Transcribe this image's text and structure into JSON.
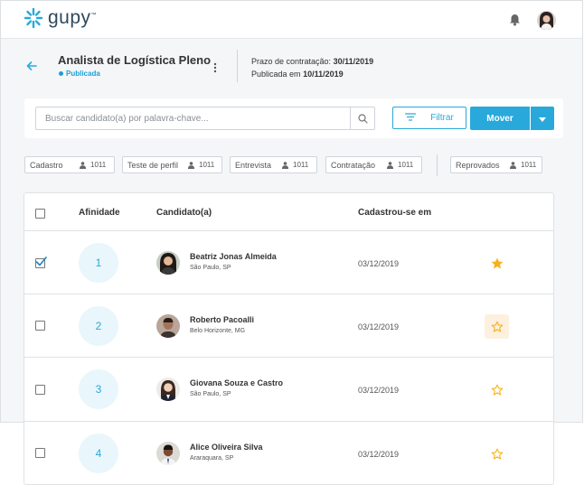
{
  "app": {
    "brand": "gupy",
    "brand_color": "#29a9db",
    "accent_star": "#f5b21d"
  },
  "topbar": {
    "icons": [
      "gupy-logo-icon",
      "bell-icon",
      "user-avatar"
    ]
  },
  "job": {
    "title": "Analista de Logística Pleno",
    "status": "Publicada",
    "deadline_label": "Prazo de contratação:",
    "deadline_value": "30/11/2019",
    "published_label": "Publicada em",
    "published_value": "10/11/2019"
  },
  "search": {
    "placeholder": "Buscar candidato(a) por palavra-chave...",
    "value": ""
  },
  "actions": {
    "filter_label": "Filtrar",
    "move_label": "Mover"
  },
  "stages": [
    {
      "label": "Cadastro",
      "count": "1011"
    },
    {
      "label": "Teste de perfil",
      "count": "1011"
    },
    {
      "label": "Entrevista",
      "count": "1011"
    },
    {
      "label": "Contratação",
      "count": "1011"
    },
    {
      "label": "Reprovados",
      "count": "1011"
    }
  ],
  "table": {
    "headers": {
      "affinity": "Afinidade",
      "candidate": "Candidato(a)",
      "registered": "Cadastrou-se em"
    },
    "rows": [
      {
        "checked": true,
        "affinity": "1",
        "name": "Beatriz Jonas Almeida",
        "location": "São Paulo, SP",
        "date": "03/12/2019",
        "starred": true
      },
      {
        "checked": false,
        "affinity": "2",
        "name": "Roberto Pacoalli",
        "location": "Belo Horizonte, MG",
        "date": "03/12/2019",
        "starred": false
      },
      {
        "checked": false,
        "affinity": "3",
        "name": "Giovana Souza e Castro",
        "location": "São Paulo, SP",
        "date": "03/12/2019",
        "starred": false
      },
      {
        "checked": false,
        "affinity": "4",
        "name": "Alice Oliveira Silva",
        "location": "Araraquara, SP",
        "date": "03/12/2019",
        "starred": false
      }
    ]
  }
}
